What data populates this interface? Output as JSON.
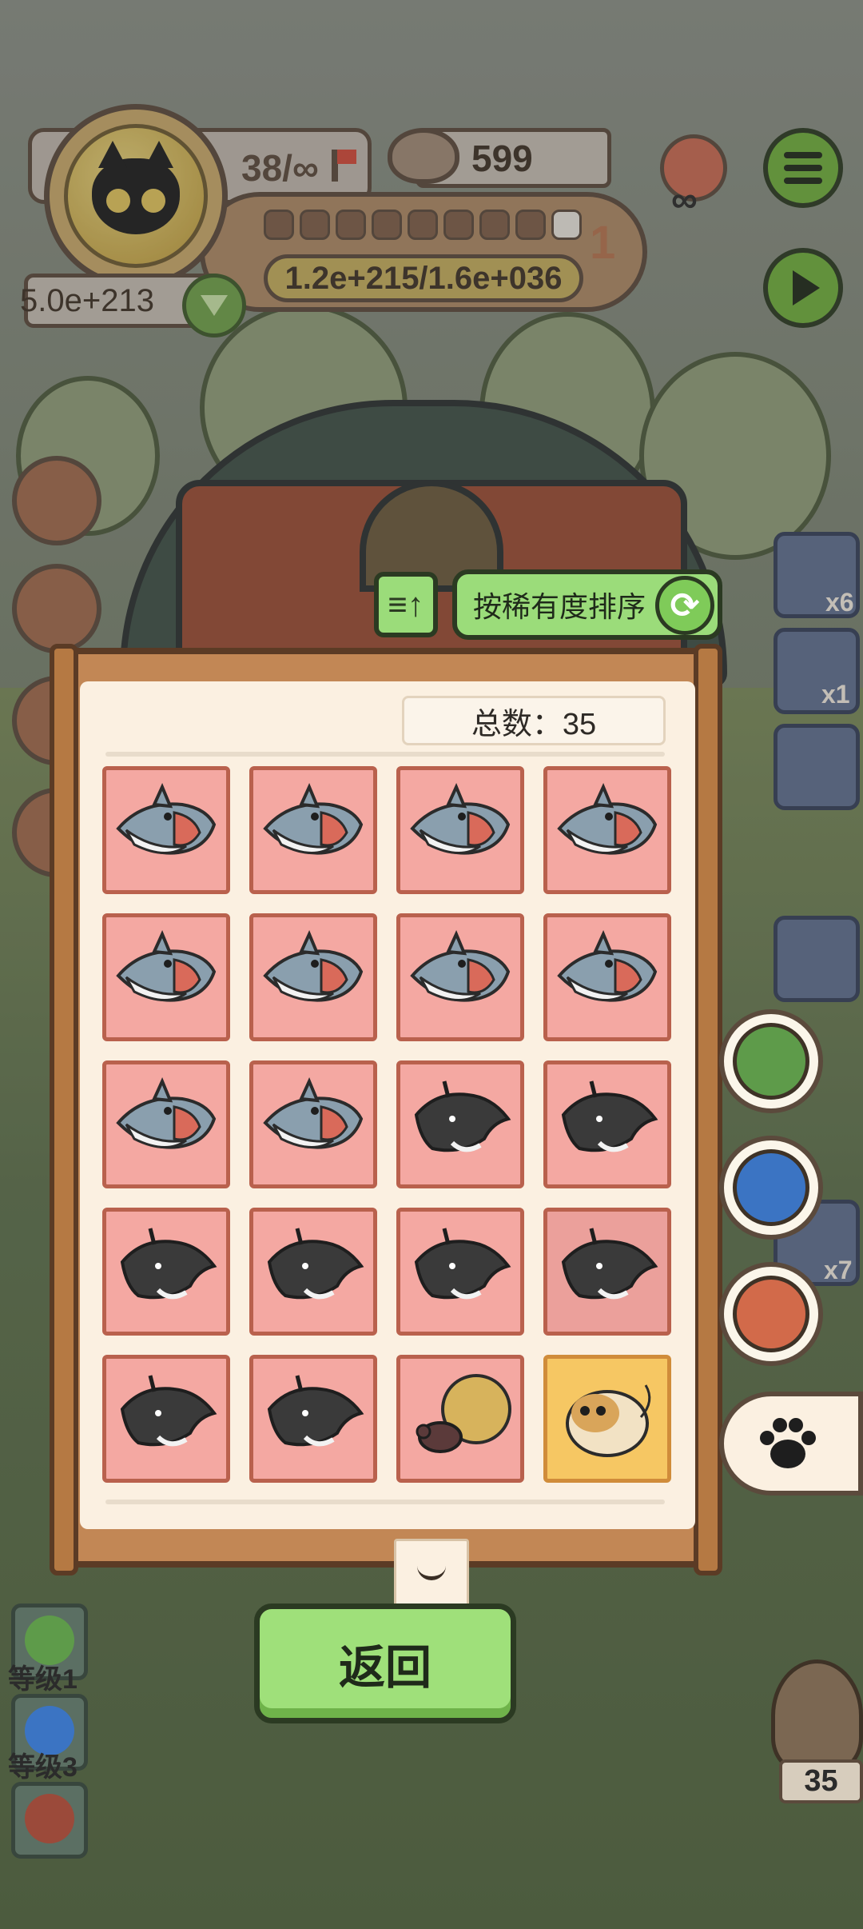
{
  "hud": {
    "lives": "38/∞",
    "coins": "599",
    "level": "1",
    "exp": "1.2e+215/1.6e+036",
    "wealth": "5.0e+213",
    "infinity_mark": "∞",
    "progress_slots": [
      false,
      false,
      false,
      false,
      false,
      false,
      false,
      false,
      true
    ]
  },
  "side_badges": {
    "x6": "x6",
    "x1": "x1",
    "x7": "x7"
  },
  "sort": {
    "label": "按稀有度排序",
    "icon": "sort-icon"
  },
  "collection": {
    "total_label": "总数：35",
    "items": [
      {
        "kind": "shark"
      },
      {
        "kind": "shark"
      },
      {
        "kind": "shark"
      },
      {
        "kind": "shark"
      },
      {
        "kind": "shark"
      },
      {
        "kind": "shark"
      },
      {
        "kind": "shark"
      },
      {
        "kind": "shark"
      },
      {
        "kind": "shark"
      },
      {
        "kind": "shark"
      },
      {
        "kind": "manta"
      },
      {
        "kind": "manta"
      },
      {
        "kind": "manta"
      },
      {
        "kind": "manta"
      },
      {
        "kind": "manta"
      },
      {
        "kind": "manta"
      },
      {
        "kind": "manta"
      },
      {
        "kind": "manta"
      },
      {
        "kind": "beetle"
      },
      {
        "kind": "hamster"
      }
    ]
  },
  "bottom": {
    "back_label": "返回",
    "level_1": "等级1",
    "level_3": "等级3",
    "owl_count": "35"
  },
  "colors": {
    "cell_red": "#f4a8a2",
    "cell_gold": "#f6c763",
    "button_green": "#9fe07a"
  }
}
